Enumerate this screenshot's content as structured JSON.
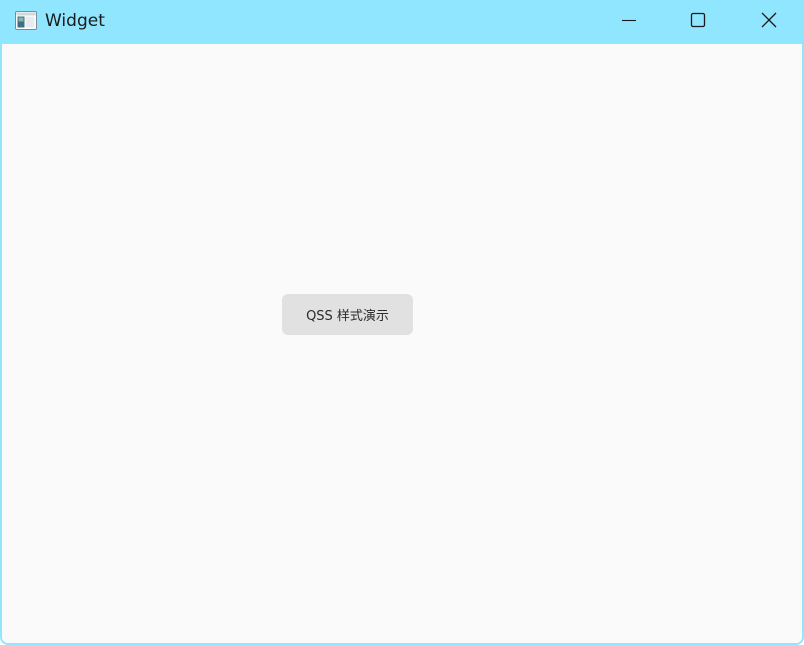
{
  "window": {
    "title": "Widget",
    "app_icon": "window-app-icon",
    "titlebar_color": "#91e6ff",
    "background_color": "#fafafa",
    "controls": {
      "minimize_icon": "minimize-icon",
      "maximize_icon": "maximize-icon",
      "close_icon": "close-icon"
    }
  },
  "main": {
    "button_label": "QSS 样式演示",
    "button_color": "#e1e1e1"
  }
}
